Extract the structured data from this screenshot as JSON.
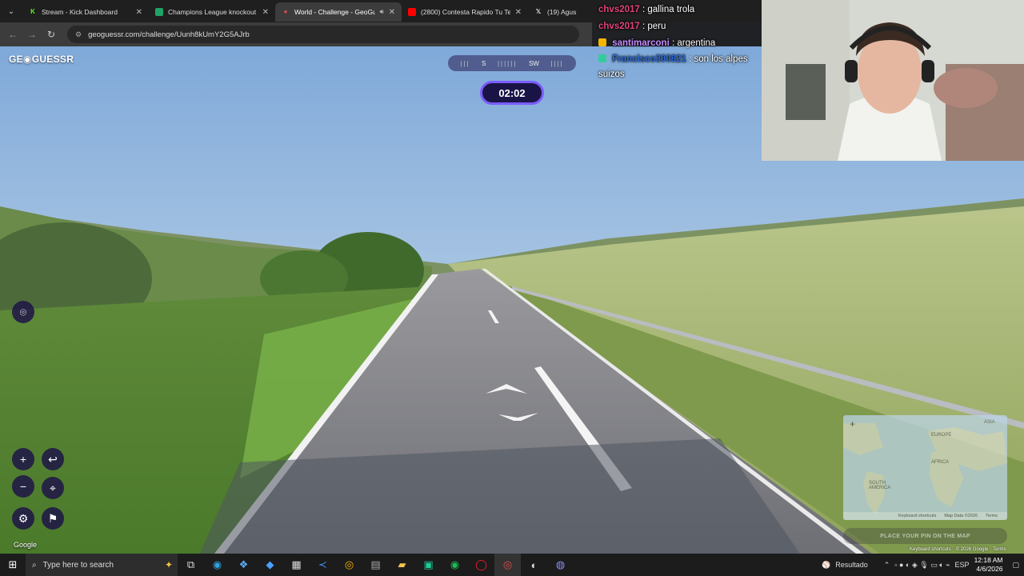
{
  "browser": {
    "tabs": [
      {
        "title": "Stream - Kick Dashboard",
        "icon": "kick-icon",
        "color": "#53fc18",
        "active": false
      },
      {
        "title": "Champions League knockout fi",
        "icon": "sheet-icon",
        "color": "#21a366",
        "active": false
      },
      {
        "title": "World - Challenge - GeoGu",
        "icon": "map-pin-icon",
        "color": "#e24b4b",
        "active": true
      },
      {
        "title": "(2800) Contesta Rapido Tu Tele",
        "icon": "youtube-icon",
        "color": "#ff0000",
        "active": false
      },
      {
        "title": "(19) Agus",
        "icon": "x-icon",
        "color": "#ffffff",
        "active": false
      }
    ],
    "url": "geoguessr.com/challenge/Uunh8kUmY2G5AJrb"
  },
  "game": {
    "logo": "GE◉GUESSR",
    "compass": {
      "left_label": "S",
      "right_label": "SW"
    },
    "timer": "02:02"
  },
  "chat": [
    {
      "user": "chvs2017",
      "message": "gallina trola",
      "color": "#e0447a"
    },
    {
      "user": "chvs2017",
      "message": "peru",
      "color": "#e0447a"
    },
    {
      "user": "santimarconi",
      "message": "argentina",
      "color": "#c48cff",
      "badge": "#f5b400"
    },
    {
      "user": "Francisco300821",
      "message": "son los alpes suizos",
      "color": "#2a6bd8",
      "badge": "#33cc99"
    }
  ],
  "minimap": {
    "labels": [
      "EUROPE",
      "AFRICA",
      "SOUTH AMERICA",
      "ASIA"
    ],
    "footer": [
      "Keyboard shortcuts",
      "Map Data ©2026",
      "Terms"
    ],
    "guess_label": "PLACE YOUR PIN ON THE MAP"
  },
  "attribution": [
    "Keyboard shortcuts",
    "© 2026 Google",
    "Terms"
  ],
  "google_mark": "Google",
  "taskbar": {
    "search_placeholder": "Type here to search",
    "tray_label": "Resultado",
    "lang": "ESP",
    "time": "12:18 AM",
    "date": "4/6/2026"
  }
}
